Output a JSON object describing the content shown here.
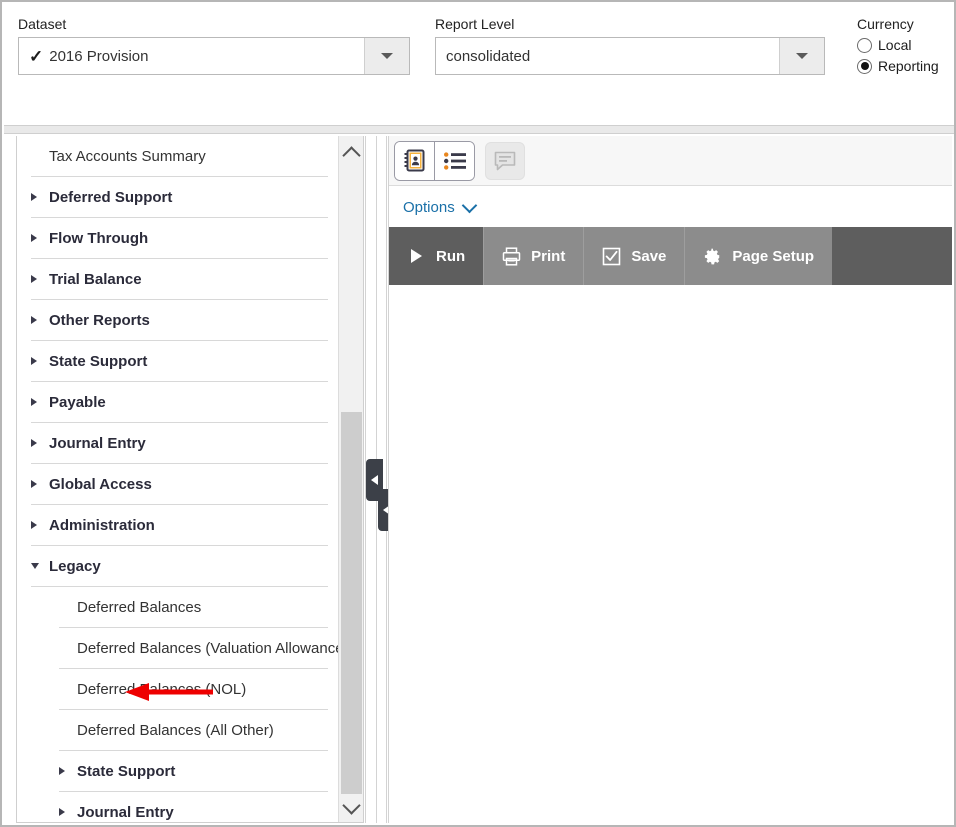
{
  "topbar": {
    "dataset": {
      "label": "Dataset",
      "value": "2016 Provision",
      "check_glyph": "✓",
      "dropdown_icon": "caret-down-icon"
    },
    "report_level": {
      "label": "Report Level",
      "value": "consolidated",
      "dropdown_icon": "caret-down-icon"
    },
    "currency": {
      "label": "Currency",
      "options": [
        {
          "label": "Local",
          "selected": false
        },
        {
          "label": "Reporting",
          "selected": true
        }
      ]
    }
  },
  "tree": {
    "rows": [
      {
        "label": "Tax Accounts Summary",
        "type": "leaf",
        "indent": 0,
        "twisty": "none"
      },
      {
        "label": "Deferred Support",
        "type": "group",
        "indent": 0,
        "twisty": "collapsed"
      },
      {
        "label": "Flow Through",
        "type": "group",
        "indent": 0,
        "twisty": "collapsed"
      },
      {
        "label": "Trial Balance",
        "type": "group",
        "indent": 0,
        "twisty": "collapsed"
      },
      {
        "label": "Other Reports",
        "type": "group",
        "indent": 0,
        "twisty": "collapsed"
      },
      {
        "label": "State Support",
        "type": "group",
        "indent": 0,
        "twisty": "collapsed"
      },
      {
        "label": "Payable",
        "type": "group",
        "indent": 0,
        "twisty": "collapsed"
      },
      {
        "label": "Journal Entry",
        "type": "group",
        "indent": 0,
        "twisty": "collapsed"
      },
      {
        "label": "Global Access",
        "type": "group",
        "indent": 0,
        "twisty": "collapsed"
      },
      {
        "label": "Administration",
        "type": "group",
        "indent": 0,
        "twisty": "collapsed"
      },
      {
        "label": "Legacy",
        "type": "group",
        "indent": 0,
        "twisty": "expanded"
      },
      {
        "label": "Deferred Balances",
        "type": "leaf",
        "indent": 1,
        "twisty": "none"
      },
      {
        "label": "Deferred Balances (Valuation Allowance)",
        "type": "leaf",
        "indent": 1,
        "twisty": "none"
      },
      {
        "label": "Deferred Balances (NOL)",
        "type": "leaf",
        "indent": 1,
        "twisty": "none"
      },
      {
        "label": "Deferred Balances (All Other)",
        "type": "leaf",
        "indent": 1,
        "twisty": "none"
      },
      {
        "label": "State Support",
        "type": "group",
        "indent": 1,
        "twisty": "collapsed"
      },
      {
        "label": "Journal Entry",
        "type": "group",
        "indent": 1,
        "twisty": "collapsed"
      }
    ],
    "scrollbar": {
      "up_arrow_icon": "chevron-up-icon",
      "down_arrow_icon": "chevron-down-icon"
    }
  },
  "annotation": {
    "arrow_color": "#ee0000",
    "points_at": "Legacy"
  },
  "splitter": {
    "handles": [
      {
        "icon": "triangle-left-icon"
      },
      {
        "icon": "triangle-left-icon"
      }
    ]
  },
  "report_panel": {
    "view_buttons": [
      {
        "icon": "address-book-icon",
        "selected": true,
        "enabled": true
      },
      {
        "icon": "list-view-icon",
        "selected": false,
        "enabled": true
      },
      {
        "icon": "comment-icon",
        "selected": false,
        "enabled": false
      }
    ],
    "options": {
      "label": "Options",
      "chevron_icon": "chevron-down-icon",
      "color": "#1a70a8"
    },
    "actions": [
      {
        "label": "Run",
        "icon": "play-icon",
        "style": "primary"
      },
      {
        "label": "Print",
        "icon": "printer-icon",
        "style": "secondary"
      },
      {
        "label": "Save",
        "icon": "checkbox-icon",
        "style": "secondary"
      },
      {
        "label": "Page Setup",
        "icon": "gear-icon",
        "style": "secondary"
      }
    ]
  },
  "colors": {
    "toolbar_primary": "#5e5e5e",
    "toolbar_secondary": "#8c8c8c",
    "link": "#1a70a8",
    "annotation_red": "#ee0000",
    "handle_dark": "#3c4048"
  }
}
